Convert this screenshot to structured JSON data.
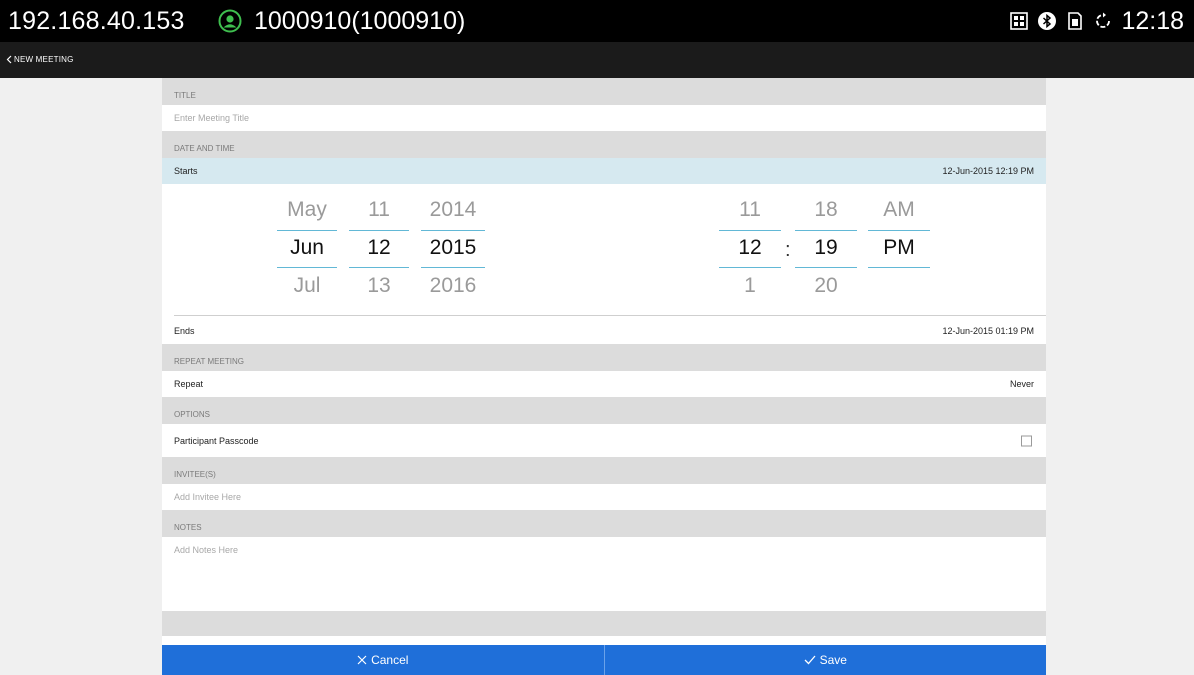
{
  "statusbar": {
    "ip": "192.168.40.153",
    "user": "1000910(1000910)",
    "time": "12:18",
    "icons": [
      "user-status-icon",
      "grid-icon",
      "bluetooth-icon",
      "sim-icon",
      "sync-icon"
    ]
  },
  "nav": {
    "back_label": "NEW MEETING"
  },
  "sections": {
    "title": "TITLE",
    "date_time": "DATE AND TIME",
    "repeat": "REPEAT MEETING",
    "options": "OPTIONS",
    "invitees": "INVITEE(S)",
    "notes": "NOTES"
  },
  "title_field": {
    "placeholder": "Enter Meeting Title"
  },
  "starts": {
    "label": "Starts",
    "value": "12-Jun-2015 12:19 PM"
  },
  "ends": {
    "label": "Ends",
    "value": "12-Jun-2015 01:19 PM"
  },
  "date_picker": {
    "month": {
      "prev": "May",
      "current": "Jun",
      "next": "Jul"
    },
    "day": {
      "prev": "11",
      "current": "12",
      "next": "13"
    },
    "year": {
      "prev": "2014",
      "current": "2015",
      "next": "2016"
    }
  },
  "time_picker": {
    "hour": {
      "prev": "11",
      "current": "12",
      "next": "1"
    },
    "minute": {
      "prev": "18",
      "current": "19",
      "next": "20"
    },
    "ampm": {
      "prev": "AM",
      "current": "PM"
    },
    "separator": ":"
  },
  "repeat": {
    "label": "Repeat",
    "value": "Never"
  },
  "passcode": {
    "label": "Participant Passcode",
    "checked": false
  },
  "invitee_field": {
    "placeholder": "Add Invitee Here"
  },
  "notes_field": {
    "placeholder": "Add Notes Here"
  },
  "footer": {
    "cancel": "Cancel",
    "save": "Save"
  },
  "colors": {
    "accent": "#1f6fd9",
    "highlight": "#d6e9f0",
    "picker_line": "#62b8d6"
  }
}
